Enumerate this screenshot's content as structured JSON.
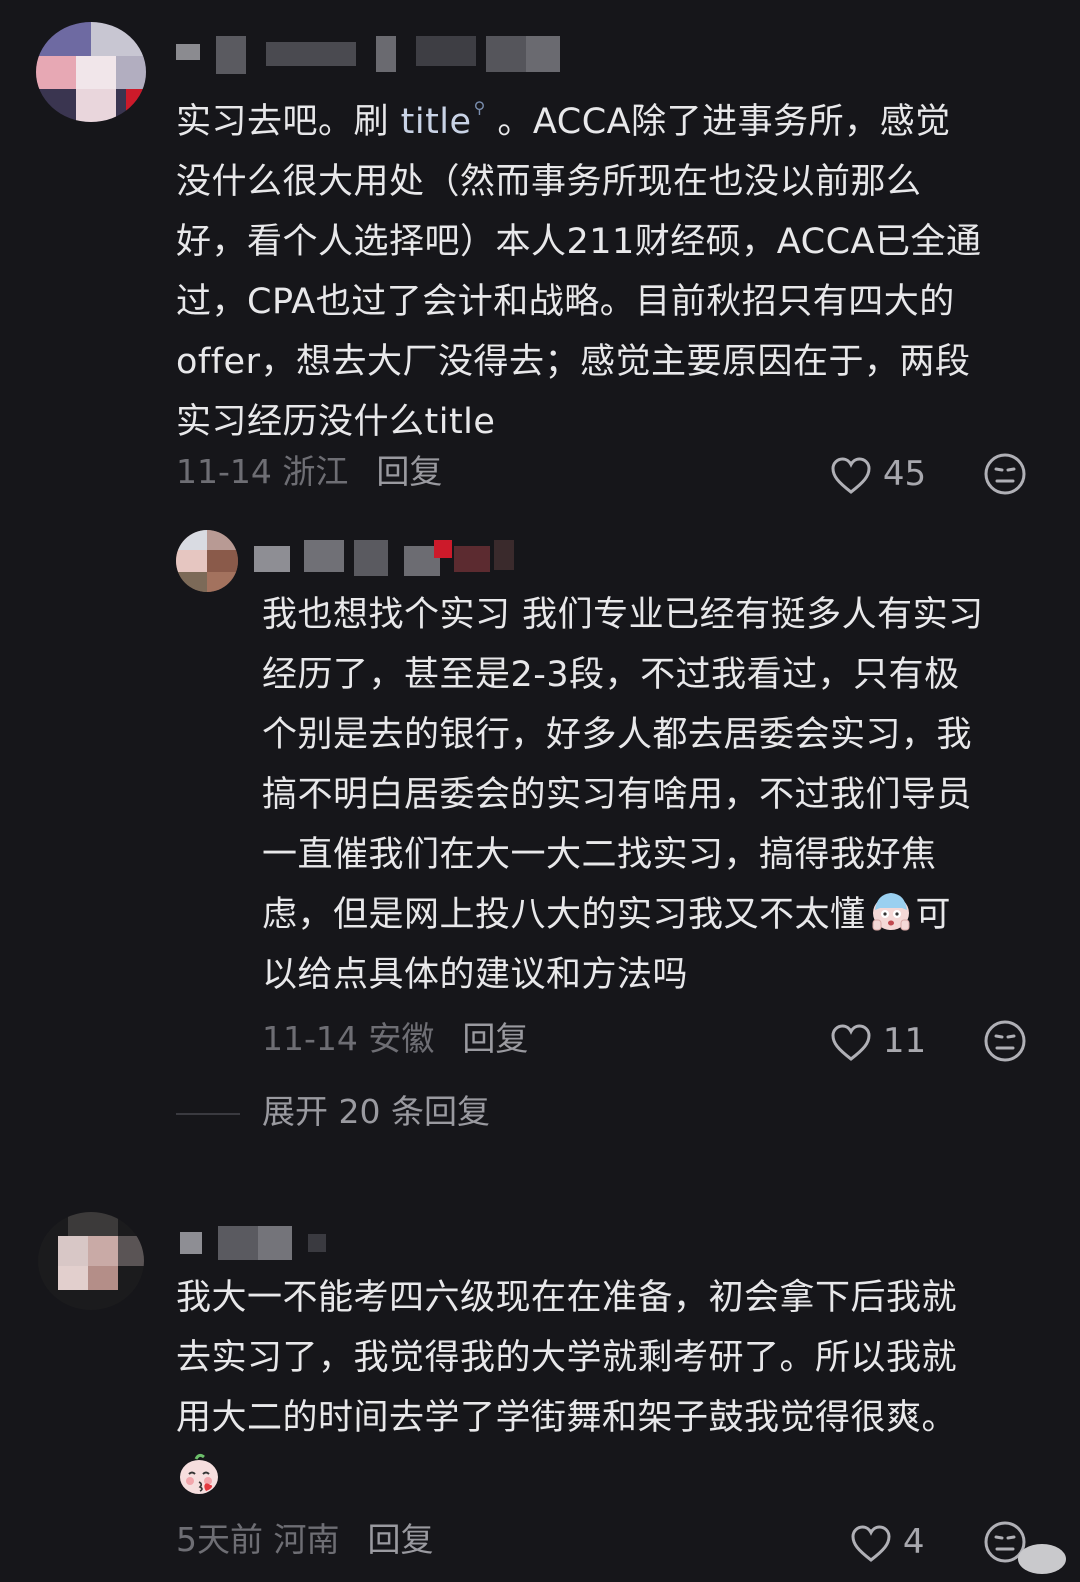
{
  "comments": [
    {
      "lines": [
        {
          "before": "实习去吧。刷 ",
          "keyword": "title",
          "after": " 。ACCA除了进事务所，感觉"
        },
        {
          "text": "没什么很大用处（然而事务所现在也没以前那么"
        },
        {
          "text": "好，看个人选择吧）本人211财经硕，ACCA已全通"
        },
        {
          "text": "过，CPA也过了会计和战略。目前秋招只有四大的"
        },
        {
          "text": " offer，想去大厂没得去；感觉主要原因在于，两段"
        },
        {
          "text": "实习经历没什么title"
        }
      ],
      "date_location": "11-14 浙江",
      "reply_label": "回复",
      "like_count": "45"
    },
    {
      "lines": [
        {
          "text": "我也想找个实习 我们专业已经有挺多人有实习"
        },
        {
          "text": "经历了，甚至是2-3段，不过我看过，只有极"
        },
        {
          "text": "个别是去的银行，好多人都去居委会实习，我"
        },
        {
          "text": "搞不明白居委会的实习有啥用，不过我们导员"
        },
        {
          "text": "一直催我们在大一大二找实习，搞得我好焦"
        },
        {
          "before": "虑，但是网上投八大的实习我又不太懂",
          "after": "可"
        },
        {
          "text": "以给点具体的建议和方法吗"
        }
      ],
      "date_location": "11-14 安徽",
      "reply_label": "回复",
      "like_count": "11"
    },
    {
      "lines": [
        {
          "text": "我大一不能考四六级现在在准备，初会拿下后我就"
        },
        {
          "text": "去实习了，我觉得我的大学就剩考研了。所以我就"
        },
        {
          "text": "用大二的时间去学了学街舞和架子鼓我觉得很爽。"
        }
      ],
      "date_location": "5天前 河南",
      "reply_label": "回复",
      "like_count": "4"
    }
  ],
  "expand_replies_label": "展开 20 条回复",
  "icons": {
    "like": "heart-outline-icon",
    "dislike": "dislike-face-icon",
    "search": "search-icon",
    "emoji_1": "scared-face-emoji",
    "emoji_2": "blushing-face-emoji"
  },
  "colors": {
    "background": "#16161a",
    "text": "#e8e8ea",
    "meta": "#6e6e74"
  }
}
